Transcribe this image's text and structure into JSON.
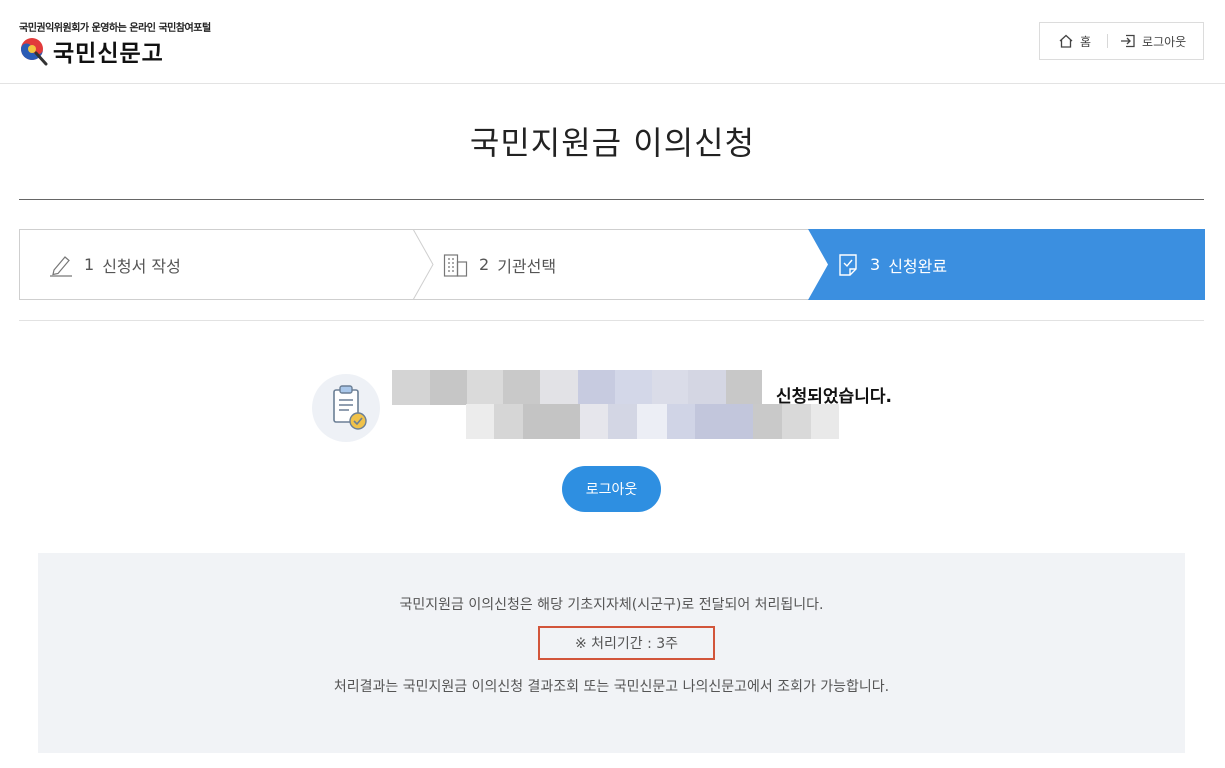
{
  "header": {
    "tagline": "국민권익위원회가 운영하는 온라인 국민참여포털",
    "logo_text": "국민신문고",
    "home_label": "홈",
    "logout_label": "로그아웃"
  },
  "page": {
    "title": "국민지원금 이의신청"
  },
  "steps": [
    {
      "number": "1",
      "label": "신청서 작성",
      "icon": "pencil-icon",
      "active": false
    },
    {
      "number": "2",
      "label": "기관선택",
      "icon": "building-icon",
      "active": false
    },
    {
      "number": "3",
      "label": "신청완료",
      "icon": "document-check-icon",
      "active": true
    }
  ],
  "result": {
    "message_suffix": "신청되었습니다.",
    "logout_button": "로그아웃"
  },
  "notice": {
    "line1": "국민지원금 이의신청은 해당 기초지자체(시군구)로 전달되어 처리됩니다.",
    "period": "※ 처리기간 : 3주",
    "line3": "처리결과는 국민지원금 이의신청 결과조회 또는 국민신문고 나의신문고에서 조회가 가능합니다."
  },
  "colors": {
    "accent": "#3b8fe0",
    "button": "#2e8fe1",
    "highlight_border": "#d2553a",
    "notice_bg": "#f1f3f6"
  }
}
